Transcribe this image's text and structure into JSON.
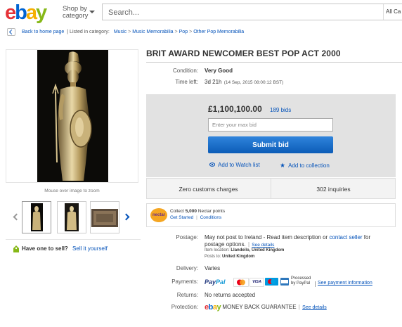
{
  "header": {
    "logo": "ebay",
    "shop_by": "Shop by",
    "category": "category",
    "search_placeholder": "Search...",
    "all_categories": "All Ca"
  },
  "breadcrumb": {
    "back": "Back to home page",
    "listed_in": "| Listed in category:",
    "items": [
      "Music",
      "Music Memorabilia",
      "Pop",
      "Other Pop Memorabilia"
    ]
  },
  "gallery": {
    "mouse_over": "Mouse over image to zoom"
  },
  "sell": {
    "question": "Have one to sell?",
    "link": "Sell it yourself"
  },
  "item": {
    "title": "BRIT AWARD NEWCOMER BEST POP ACT 2000",
    "condition_label": "Condition:",
    "condition": "Very Good",
    "time_left_label": "Time left:",
    "time_left": "3d 21h",
    "end_time": "(14 Sep, 2015   08:00:12 BST)"
  },
  "bid": {
    "price": "£1,100,100.00",
    "bids": "189 bids",
    "max_bid_placeholder": "Enter your max bid",
    "submit": "Submit bid",
    "watch": "Add to Watch list",
    "collection": "Add to collection",
    "customs": "Zero customs charges",
    "inquiries": "302 inquiries"
  },
  "nectar": {
    "logo": "nectar",
    "collect_prefix": "Collect ",
    "points": "5,000",
    "collect_suffix": " Nectar points",
    "get_started": "Get Started",
    "conditions": "Conditions"
  },
  "details": {
    "postage_label": "Postage:",
    "postage_text": "May not post to Ireland - Read item description or",
    "contact_seller": "contact seller",
    "postage_for": " for",
    "postage_options": "postage options.",
    "see_details": "See details",
    "item_location_label": "Item location:",
    "item_location": "Llandeilo, United Kingdom",
    "posts_to_label": "Posts to:",
    "posts_to": "United Kingdom",
    "delivery_label": "Delivery:",
    "delivery": "Varies",
    "payments_label": "Payments:",
    "paypal_1": "Pay",
    "paypal_2": "Pal",
    "processed_1": "Processed",
    "processed_2": "by PayPal",
    "see_payment": "See payment information",
    "returns_label": "Returns:",
    "returns": "No returns accepted",
    "protection_label": "Protection:",
    "protection": "MONEY BACK GUARANTEE",
    "protection_details": "See details"
  },
  "colors": {
    "link": "#0654ba",
    "button": "#0c5cb7",
    "bid_box": "#e2e2e2"
  }
}
